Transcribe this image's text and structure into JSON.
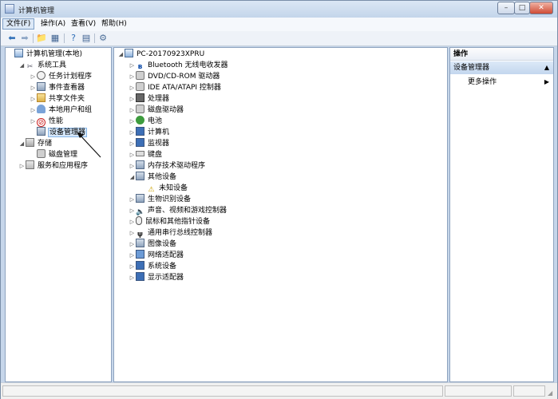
{
  "window": {
    "title": "计算机管理",
    "controls": {
      "minimize": "–",
      "maximize": "□",
      "close": "✕"
    }
  },
  "menu": [
    {
      "label": "文件(F)",
      "name": "menu-file",
      "active": true
    },
    {
      "label": "操作(A)",
      "name": "menu-action",
      "active": false
    },
    {
      "label": "查看(V)",
      "name": "menu-view",
      "active": false
    },
    {
      "label": "帮助(H)",
      "name": "menu-help",
      "active": false
    }
  ],
  "toolbar": [
    {
      "name": "back-button",
      "icon": "arrow-left-icon",
      "glyph": "⬅",
      "color": "#2f6fb7"
    },
    {
      "name": "forward-button",
      "icon": "arrow-right-icon",
      "glyph": "➡",
      "color": "#8aa4c4"
    },
    {
      "name": "up-folder-button",
      "icon": "folder-up-icon",
      "glyph": "📁",
      "color": "#c59a2e"
    },
    {
      "name": "show-hide-tree-button",
      "icon": "console-tree-icon",
      "glyph": "▦",
      "color": "#3b5f8f"
    },
    {
      "name": "help-button",
      "icon": "help-icon",
      "glyph": "?",
      "color": "#2f6fb7"
    },
    {
      "name": "properties-button",
      "icon": "properties-icon",
      "glyph": "▤",
      "color": "#3b5f8f"
    },
    {
      "name": "scan-hardware-button",
      "icon": "scan-hardware-icon",
      "glyph": "⚙",
      "color": "#4d6f99"
    }
  ],
  "tree": [
    {
      "label": "计算机管理(本地)",
      "icon": "computer-icon",
      "cls": "pc",
      "glyph": "",
      "expander": "",
      "name": "tree-computer-management",
      "selected": false
    },
    {
      "label": "系统工具",
      "icon": "tools-icon",
      "cls": "tool",
      "glyph": "✂",
      "expander": "◢",
      "name": "tree-system-tools",
      "selected": false
    },
    {
      "label": "任务计划程序",
      "icon": "clock-icon",
      "cls": "clock",
      "glyph": "",
      "expander": "▷",
      "name": "tree-task-scheduler",
      "selected": false
    },
    {
      "label": "事件查看器",
      "icon": "event-viewer-icon",
      "cls": "dev",
      "glyph": "",
      "expander": "▷",
      "name": "tree-event-viewer",
      "selected": false
    },
    {
      "label": "共享文件夹",
      "icon": "shared-folder-icon",
      "cls": "folder",
      "glyph": "",
      "expander": "▷",
      "name": "tree-shared-folders",
      "selected": false
    },
    {
      "label": "本地用户和组",
      "icon": "users-icon",
      "cls": "users",
      "glyph": "",
      "expander": "▷",
      "name": "tree-local-users-groups",
      "selected": false
    },
    {
      "label": "性能",
      "icon": "performance-icon",
      "cls": "perf",
      "glyph": "⊘",
      "expander": "▷",
      "name": "tree-performance",
      "selected": false
    },
    {
      "label": "设备管理器",
      "icon": "device-manager-icon",
      "cls": "dev",
      "glyph": "",
      "expander": "",
      "name": "tree-device-manager",
      "selected": true
    },
    {
      "label": "存储",
      "icon": "storage-icon",
      "cls": "store",
      "glyph": "",
      "expander": "◢",
      "name": "tree-storage",
      "selected": false
    },
    {
      "label": "磁盘管理",
      "icon": "disk-management-icon",
      "cls": "disk",
      "glyph": "",
      "expander": "",
      "name": "tree-disk-management",
      "selected": false
    },
    {
      "label": "服务和应用程序",
      "icon": "services-icon",
      "cls": "svc",
      "glyph": "",
      "expander": "▷",
      "name": "tree-services-apps",
      "selected": false
    }
  ],
  "devices": [
    {
      "label": "PC-20170923XPRU",
      "icon": "computer-icon",
      "cls": "pc",
      "glyph": "",
      "expander": "◢",
      "name": "device-root"
    },
    {
      "label": "Bluetooth 无线电收发器",
      "icon": "bluetooth-icon",
      "cls": "bt",
      "glyph": "ʙ",
      "expander": "▷",
      "name": "device-bluetooth"
    },
    {
      "label": "DVD/CD-ROM 驱动器",
      "icon": "dvd-icon",
      "cls": "disk",
      "glyph": "",
      "expander": "▷",
      "name": "device-dvd"
    },
    {
      "label": "IDE ATA/ATAPI 控制器",
      "icon": "ide-controller-icon",
      "cls": "disk",
      "glyph": "",
      "expander": "▷",
      "name": "device-ide"
    },
    {
      "label": "处理器",
      "icon": "processor-icon",
      "cls": "chip",
      "glyph": "",
      "expander": "▷",
      "name": "device-processor"
    },
    {
      "label": "磁盘驱动器",
      "icon": "disk-drive-icon",
      "cls": "disk",
      "glyph": "",
      "expander": "▷",
      "name": "device-disk-drive"
    },
    {
      "label": "电池",
      "icon": "battery-icon",
      "cls": "batt",
      "glyph": "",
      "expander": "▷",
      "name": "device-battery"
    },
    {
      "label": "计算机",
      "icon": "computer-icon",
      "cls": "mon",
      "glyph": "",
      "expander": "▷",
      "name": "device-computer"
    },
    {
      "label": "监视器",
      "icon": "monitor-icon",
      "cls": "mon",
      "glyph": "",
      "expander": "▷",
      "name": "device-monitor"
    },
    {
      "label": "键盘",
      "icon": "keyboard-icon",
      "cls": "kb",
      "glyph": "",
      "expander": "▷",
      "name": "device-keyboard"
    },
    {
      "label": "内存技术驱动程序",
      "icon": "memory-driver-icon",
      "cls": "dev",
      "glyph": "",
      "expander": "▷",
      "name": "device-memory-tech"
    },
    {
      "label": "其他设备",
      "icon": "other-devices-icon",
      "cls": "dev",
      "glyph": "",
      "expander": "◢",
      "name": "device-other"
    },
    {
      "label": "未知设备",
      "icon": "unknown-device-warning-icon",
      "cls": "warn",
      "glyph": "⚠",
      "expander": "",
      "name": "device-unknown"
    },
    {
      "label": "生物识别设备",
      "icon": "biometric-icon",
      "cls": "dev",
      "glyph": "",
      "expander": "▷",
      "name": "device-biometric"
    },
    {
      "label": "声音、视频和游戏控制器",
      "icon": "speaker-icon",
      "cls": "spk",
      "glyph": "🔈",
      "expander": "▷",
      "name": "device-sound"
    },
    {
      "label": "鼠标和其他指针设备",
      "icon": "mouse-icon",
      "cls": "mouse",
      "glyph": "",
      "expander": "▷",
      "name": "device-mouse"
    },
    {
      "label": "通用串行总线控制器",
      "icon": "usb-icon",
      "cls": "usb",
      "glyph": "ψ",
      "expander": "▷",
      "name": "device-usb"
    },
    {
      "label": "图像设备",
      "icon": "imaging-icon",
      "cls": "dev",
      "glyph": "",
      "expander": "▷",
      "name": "device-imaging"
    },
    {
      "label": "网络适配器",
      "icon": "network-icon",
      "cls": "net",
      "glyph": "",
      "expander": "▷",
      "name": "device-network"
    },
    {
      "label": "系统设备",
      "icon": "system-device-icon",
      "cls": "mon",
      "glyph": "",
      "expander": "▷",
      "name": "device-system"
    },
    {
      "label": "显示适配器",
      "icon": "display-adapter-icon",
      "cls": "mon",
      "glyph": "",
      "expander": "▷",
      "name": "device-display"
    }
  ],
  "actions": {
    "header": "操作",
    "section": "设备管理器",
    "section_toggle": "▲",
    "more": "更多操作",
    "more_arrow": "▶"
  }
}
